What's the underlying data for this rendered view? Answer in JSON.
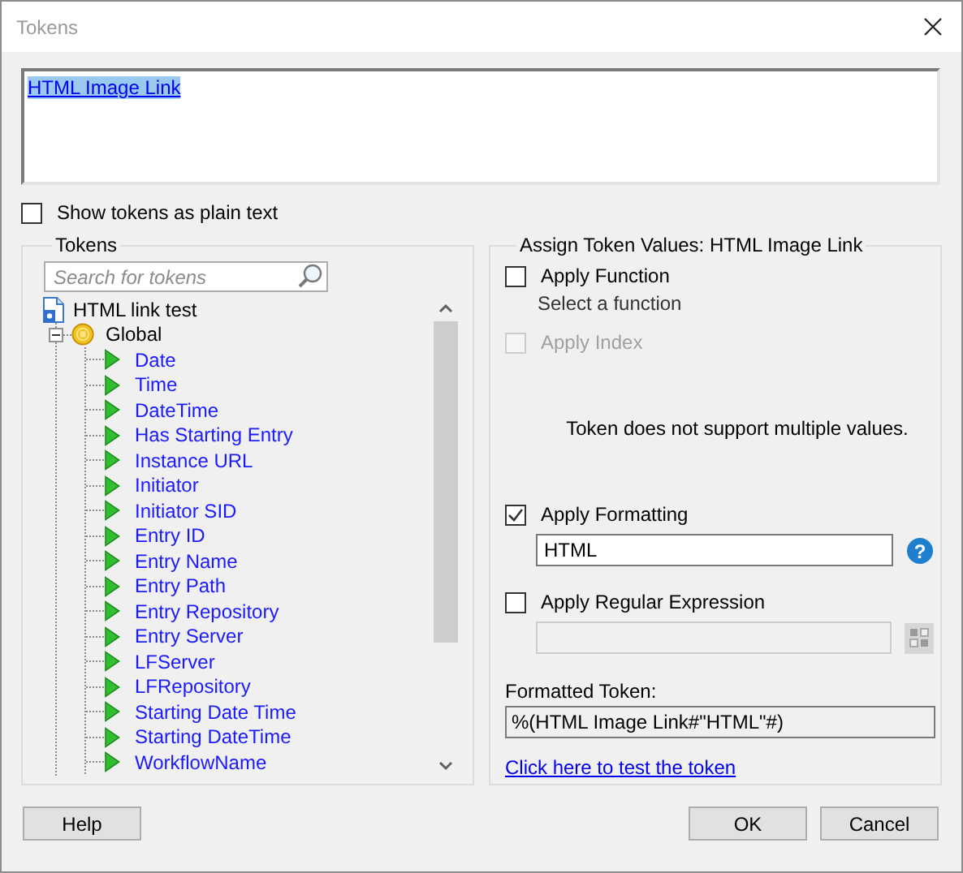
{
  "window": {
    "title": "Tokens"
  },
  "token_editor": {
    "text": "HTML Image Link",
    "selected": true
  },
  "show_plain_text": {
    "label": "Show tokens as plain text",
    "checked": false
  },
  "tokens_panel": {
    "title": "Tokens",
    "search": {
      "placeholder": "Search for tokens"
    },
    "tree": {
      "label": "HTML link test",
      "children": [
        {
          "label": "Global",
          "expanded": true,
          "children": [
            {
              "label": "Date"
            },
            {
              "label": "Time"
            },
            {
              "label": "DateTime"
            },
            {
              "label": "Has Starting Entry"
            },
            {
              "label": "Instance URL"
            },
            {
              "label": "Initiator"
            },
            {
              "label": "Initiator SID"
            },
            {
              "label": "Entry ID"
            },
            {
              "label": "Entry Name"
            },
            {
              "label": "Entry Path"
            },
            {
              "label": "Entry Repository"
            },
            {
              "label": "Entry Server"
            },
            {
              "label": "LFServer"
            },
            {
              "label": "LFRepository"
            },
            {
              "label": "Starting Date Time"
            },
            {
              "label": "Starting DateTime"
            },
            {
              "label": "WorkflowName"
            }
          ]
        }
      ]
    }
  },
  "assign_panel": {
    "title": "Assign Token Values: HTML Image Link",
    "apply_function": {
      "label": "Apply Function",
      "checked": false,
      "hint": "Select a function"
    },
    "apply_index": {
      "label": "Apply Index",
      "checked": false,
      "disabled": true
    },
    "message": "Token does not support multiple values.",
    "apply_formatting": {
      "label": "Apply Formatting",
      "checked": true,
      "value": "HTML",
      "help": "?"
    },
    "apply_regex": {
      "label": "Apply Regular Expression",
      "checked": false
    },
    "formatted_token": {
      "label": "Formatted Token:",
      "value": "%(HTML Image Link#\"HTML\"#)"
    },
    "test_link": "Click here to test the token"
  },
  "buttons": [
    {
      "label": "Help",
      "kind": "help"
    },
    {
      "label": "OK",
      "kind": "ok"
    },
    {
      "label": "Cancel",
      "kind": "cancel"
    }
  ]
}
